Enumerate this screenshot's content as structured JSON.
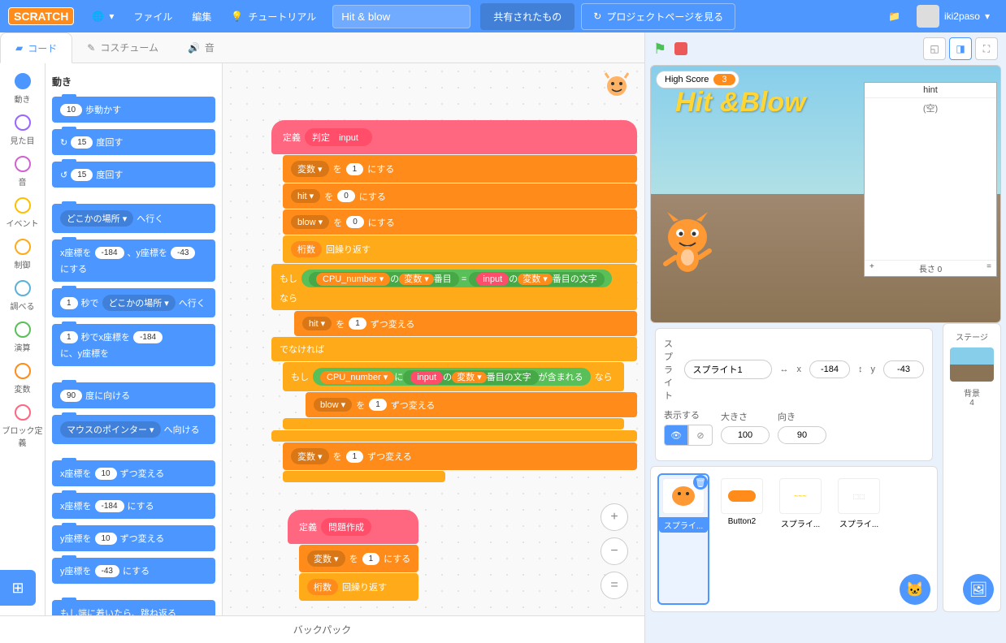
{
  "menubar": {
    "logo": "SCRATCH",
    "file": "ファイル",
    "edit": "編集",
    "tutorials": "チュートリアル",
    "project_title": "Hit & blow",
    "share": "共有されたもの",
    "project_page": "プロジェクトページを見る",
    "username": "iki2paso"
  },
  "tabs": {
    "code": "コード",
    "costumes": "コスチューム",
    "sounds": "音"
  },
  "categories": [
    {
      "name": "動き",
      "color": "#4c97ff"
    },
    {
      "name": "見た目",
      "color": "#9966ff"
    },
    {
      "name": "音",
      "color": "#cf63cf"
    },
    {
      "name": "イベント",
      "color": "#ffbf00"
    },
    {
      "name": "制御",
      "color": "#ffab19"
    },
    {
      "name": "調べる",
      "color": "#5cb1d6"
    },
    {
      "name": "演算",
      "color": "#59c059"
    },
    {
      "name": "変数",
      "color": "#ff8c1a"
    },
    {
      "name": "ブロック定義",
      "color": "#ff6680"
    }
  ],
  "palette": {
    "header": "動き",
    "blocks": {
      "move": {
        "val": "10",
        "txt": "歩動かす"
      },
      "turn_r": {
        "val": "15",
        "txt": "度回す"
      },
      "turn_l": {
        "val": "15",
        "txt": "度回す"
      },
      "goto": {
        "dd": "どこかの場所 ▾",
        "txt": "へ行く"
      },
      "gotoxy": {
        "p1": "x座標を",
        "v1": "-184",
        "p2": "、y座標を",
        "v2": "-43",
        "p3": "にする"
      },
      "glide": {
        "v1": "1",
        "p1": "秒で",
        "dd": "どこかの場所 ▾",
        "p2": "へ行く"
      },
      "glidexy": {
        "v1": "1",
        "p1": "秒でx座標を",
        "v2": "-184",
        "p2": "に、y座標を"
      },
      "point_dir": {
        "v": "90",
        "txt": "度に向ける"
      },
      "point_to": {
        "dd": "マウスのポインター ▾",
        "txt": "へ向ける"
      },
      "changex": {
        "p1": "x座標を",
        "v": "10",
        "p2": "ずつ変える"
      },
      "setx": {
        "p1": "x座標を",
        "v": "-184",
        "p2": "にする"
      },
      "changey": {
        "p1": "y座標を",
        "v": "10",
        "p2": "ずつ変える"
      },
      "sety": {
        "p1": "y座標を",
        "v": "-43",
        "p2": "にする"
      },
      "bounce": "もし端に着いたら、跳ね返る"
    }
  },
  "script1": {
    "define": "定義",
    "proc": "判定",
    "arg": "input",
    "set": "を",
    "set_to": "にする",
    "var": "変数 ▾",
    "hit": "hit ▾",
    "blow": "blow ▾",
    "v1": "1",
    "v0": "0",
    "repeat_var": "桁数",
    "repeat": "回繰り返す",
    "if": "もし",
    "then": "なら",
    "else": "でなければ",
    "cpu": "CPU_number ▾",
    "of": "の",
    "item": "番目",
    "eq": "=",
    "letter": "番目の文字",
    "change": "ずつ変える",
    "contains_in": "に",
    "contains": "が含まれる"
  },
  "script2": {
    "define": "定義",
    "proc": "問題作成",
    "var": "変数 ▾",
    "to": "を",
    "v1": "1",
    "set": "にする",
    "rep_var": "桁数",
    "rep": "回繰り返す"
  },
  "stage": {
    "high_score_lbl": "High Score",
    "high_score_val": "3",
    "title": "Hit &Blow",
    "hint_hdr": "hint",
    "hint_empty": "(空)",
    "hint_len": "長さ 0",
    "hint_plus": "+",
    "hint_eq": "="
  },
  "sprite_info": {
    "label": "スプライト",
    "name": "スプライト1",
    "x_lbl": "x",
    "x": "-184",
    "y_lbl": "y",
    "y": "-43",
    "show": "表示する",
    "size_lbl": "大きさ",
    "size": "100",
    "dir_lbl": "向き",
    "dir": "90"
  },
  "sprites": [
    {
      "name": "スプライ..."
    },
    {
      "name": "Button2"
    },
    {
      "name": "スプライ..."
    },
    {
      "name": "スプライ..."
    }
  ],
  "stage_sel": {
    "label": "ステージ",
    "backdrops": "背景",
    "count": "4"
  },
  "backpack": "バックパック"
}
